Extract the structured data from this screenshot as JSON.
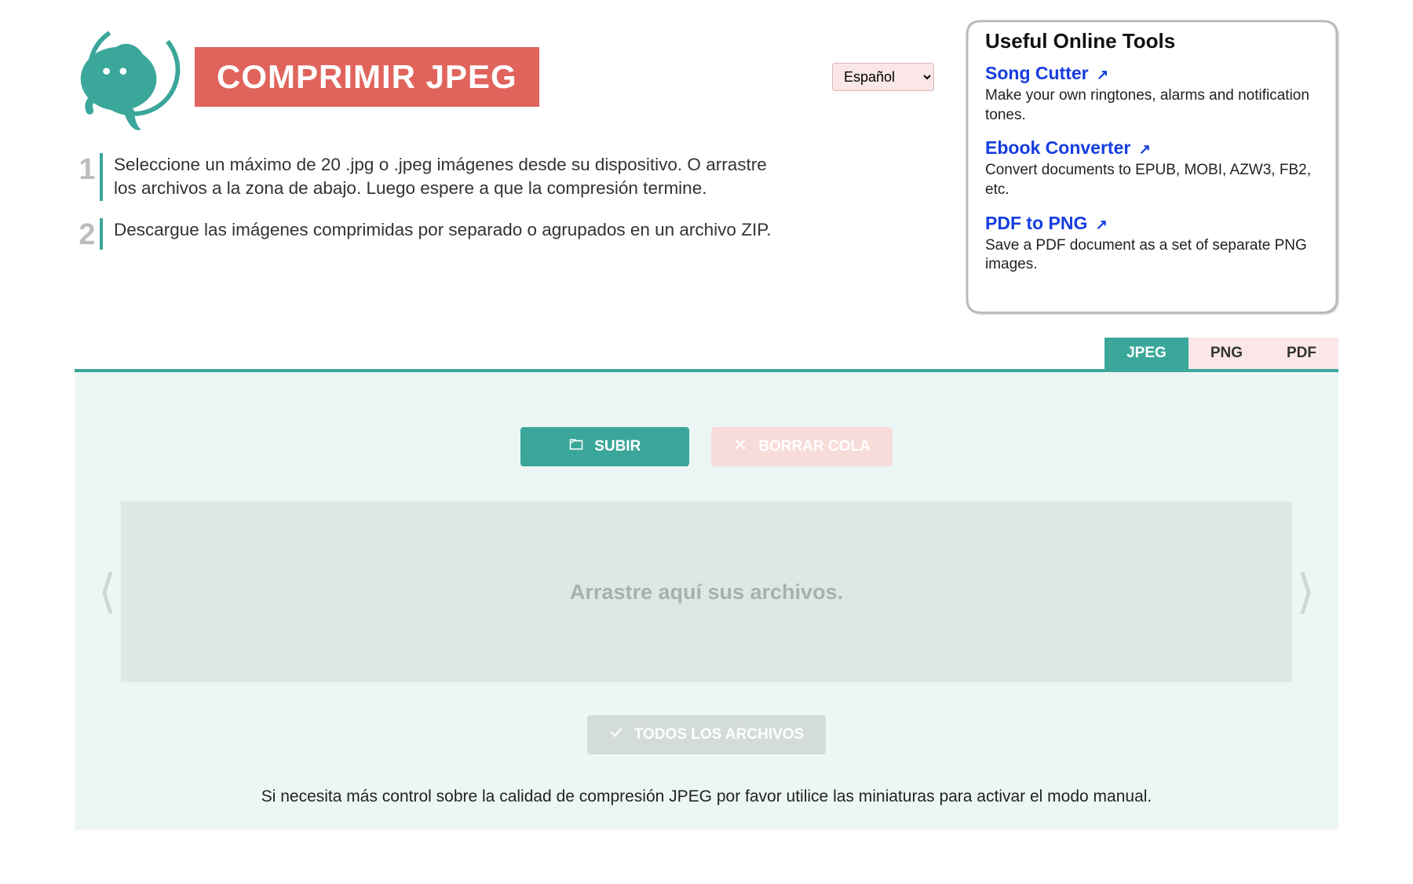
{
  "language": {
    "selected": "Español"
  },
  "header": {
    "title": "COMPRIMIR JPEG"
  },
  "steps": [
    {
      "num": "1",
      "text": "Seleccione un máximo de 20 .jpg o .jpeg imágenes desde su dispositivo. O arrastre los archivos a la zona de abajo. Luego espere a que la compresión termine."
    },
    {
      "num": "2",
      "text": "Descargue las imágenes comprimidas por separado o agrupados en un archivo ZIP."
    }
  ],
  "sidebar": {
    "title": "Useful Online Tools",
    "tools": [
      {
        "name": "Song Cutter",
        "desc": "Make your own ringtones, alarms and notification tones."
      },
      {
        "name": "Ebook Converter",
        "desc": "Convert documents to EPUB, MOBI, AZW3, FB2, etc."
      },
      {
        "name": "PDF to PNG",
        "desc": "Save a PDF document as a set of separate PNG images."
      }
    ]
  },
  "tabs": [
    {
      "label": "JPEG",
      "active": true
    },
    {
      "label": "PNG",
      "active": false
    },
    {
      "label": "PDF",
      "active": false
    }
  ],
  "buttons": {
    "upload": "SUBIR",
    "clear": "BORRAR COLA",
    "download_all": "TODOS LOS ARCHIVOS"
  },
  "dropzone": {
    "text": "Arrastre aquí sus archivos."
  },
  "hint": "Si necesita más control sobre la calidad de compresión JPEG por favor utilice las miniaturas para activar el modo manual."
}
